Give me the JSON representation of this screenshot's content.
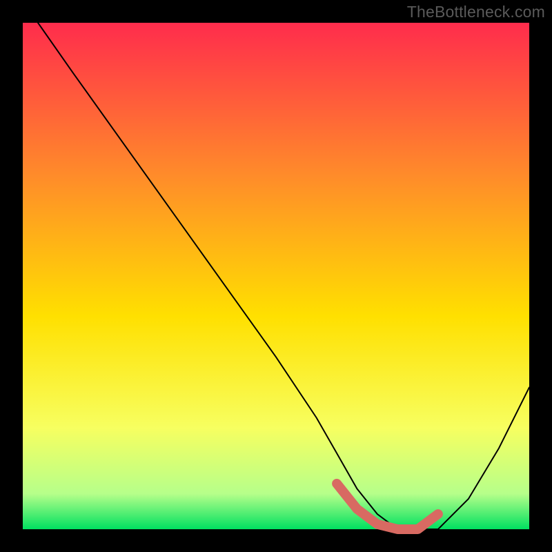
{
  "watermark": "TheBottleneck.com",
  "chart_data": {
    "type": "line",
    "title": "",
    "xlabel": "",
    "ylabel": "",
    "xlim": [
      0,
      100
    ],
    "ylim": [
      0,
      100
    ],
    "grid": false,
    "background_gradient": {
      "top": "#ff2c4c",
      "upper_mid": "#ff8b2a",
      "mid": "#ffe000",
      "lower_mid": "#f7ff60",
      "near_bottom": "#b6ff8a",
      "bottom": "#00e060"
    },
    "series": [
      {
        "name": "bottleneck-curve",
        "color": "#000000",
        "x": [
          3,
          10,
          20,
          30,
          40,
          50,
          58,
          62,
          66,
          70,
          74,
          78,
          82,
          88,
          94,
          100
        ],
        "y": [
          100,
          90,
          76,
          62,
          48,
          34,
          22,
          15,
          8,
          3,
          0,
          0,
          0,
          6,
          16,
          28
        ]
      }
    ],
    "highlight_segment": {
      "name": "sweet-spot",
      "color": "#d86a62",
      "x": [
        62,
        66,
        70,
        74,
        78,
        82
      ],
      "y": [
        9,
        4,
        1,
        0,
        0,
        3
      ]
    }
  }
}
